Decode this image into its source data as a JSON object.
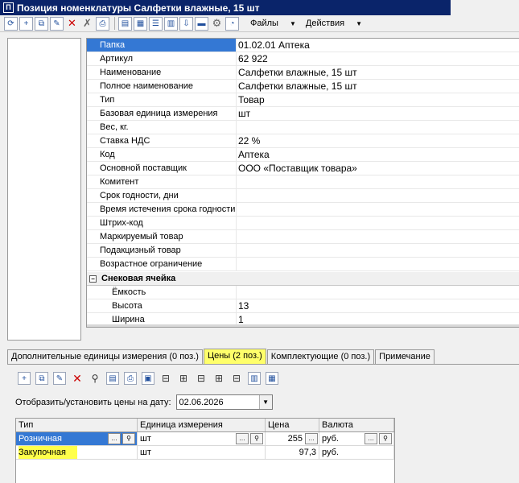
{
  "window": {
    "title": "Позиция номенклатуры Салфетки влажные, 15 шт",
    "icon_letter": "П"
  },
  "menu": {
    "files": "Файлы",
    "actions": "Действия"
  },
  "properties": [
    {
      "name": "Папка",
      "value": "01.02.01 Аптека",
      "selected": true
    },
    {
      "name": "Артикул",
      "value": "62 922"
    },
    {
      "name": "Наименование",
      "value": "Салфетки влажные, 15 шт"
    },
    {
      "name": "Полное наименование",
      "value": "Салфетки влажные, 15 шт"
    },
    {
      "name": "Тип",
      "value": "Товар"
    },
    {
      "name": "Базовая единица измерения",
      "value": "шт"
    },
    {
      "name": "Вес, кг.",
      "value": ""
    },
    {
      "name": "Ставка НДС",
      "value": "22 %"
    },
    {
      "name": "Код",
      "value": "Аптека"
    },
    {
      "name": "Основной поставщик",
      "value": "ООО «Поставщик товара»"
    },
    {
      "name": "Комитент",
      "value": ""
    },
    {
      "name": "Срок годности, дни",
      "value": ""
    },
    {
      "name": "Время истечения срока годности",
      "value": ""
    },
    {
      "name": "Штрих-код",
      "value": ""
    },
    {
      "name": "Маркируемый товар",
      "value": ""
    },
    {
      "name": "Подакцизный товар",
      "value": ""
    },
    {
      "name": "Возрастное ограничение",
      "value": ""
    }
  ],
  "group": {
    "title": "Снековая ячейка",
    "items": [
      {
        "name": "Ёмкость",
        "value": ""
      },
      {
        "name": "Высота",
        "value": "13"
      },
      {
        "name": "Ширина",
        "value": "1"
      }
    ]
  },
  "tabs": [
    {
      "label": "Дополнительные единицы измерения (0 поз.)",
      "active": false
    },
    {
      "label": "Цены (2 поз.)",
      "active": true
    },
    {
      "label": "Комплектующие (0 поз.)",
      "active": false
    },
    {
      "label": "Примечание",
      "active": false
    }
  ],
  "prices": {
    "date_label": "Отобразить/установить цены на дату:",
    "date_value": "02.06.2026",
    "columns": [
      "Тип",
      "Единица измерения",
      "Цена",
      "Валюта"
    ],
    "rows": [
      {
        "type": "Розничная",
        "unit": "шт",
        "price": "255",
        "currency": "руб."
      },
      {
        "type": "Закупочная",
        "unit": "шт",
        "price": "97,3",
        "currency": "руб."
      }
    ]
  },
  "icons": {
    "ellipsis": "…",
    "search": "🔍",
    "dropdown": "▼",
    "minus": "−"
  },
  "colors": {
    "title_bg": "#0a246a",
    "selection": "#3478d4",
    "highlight": "#ffff4a"
  }
}
